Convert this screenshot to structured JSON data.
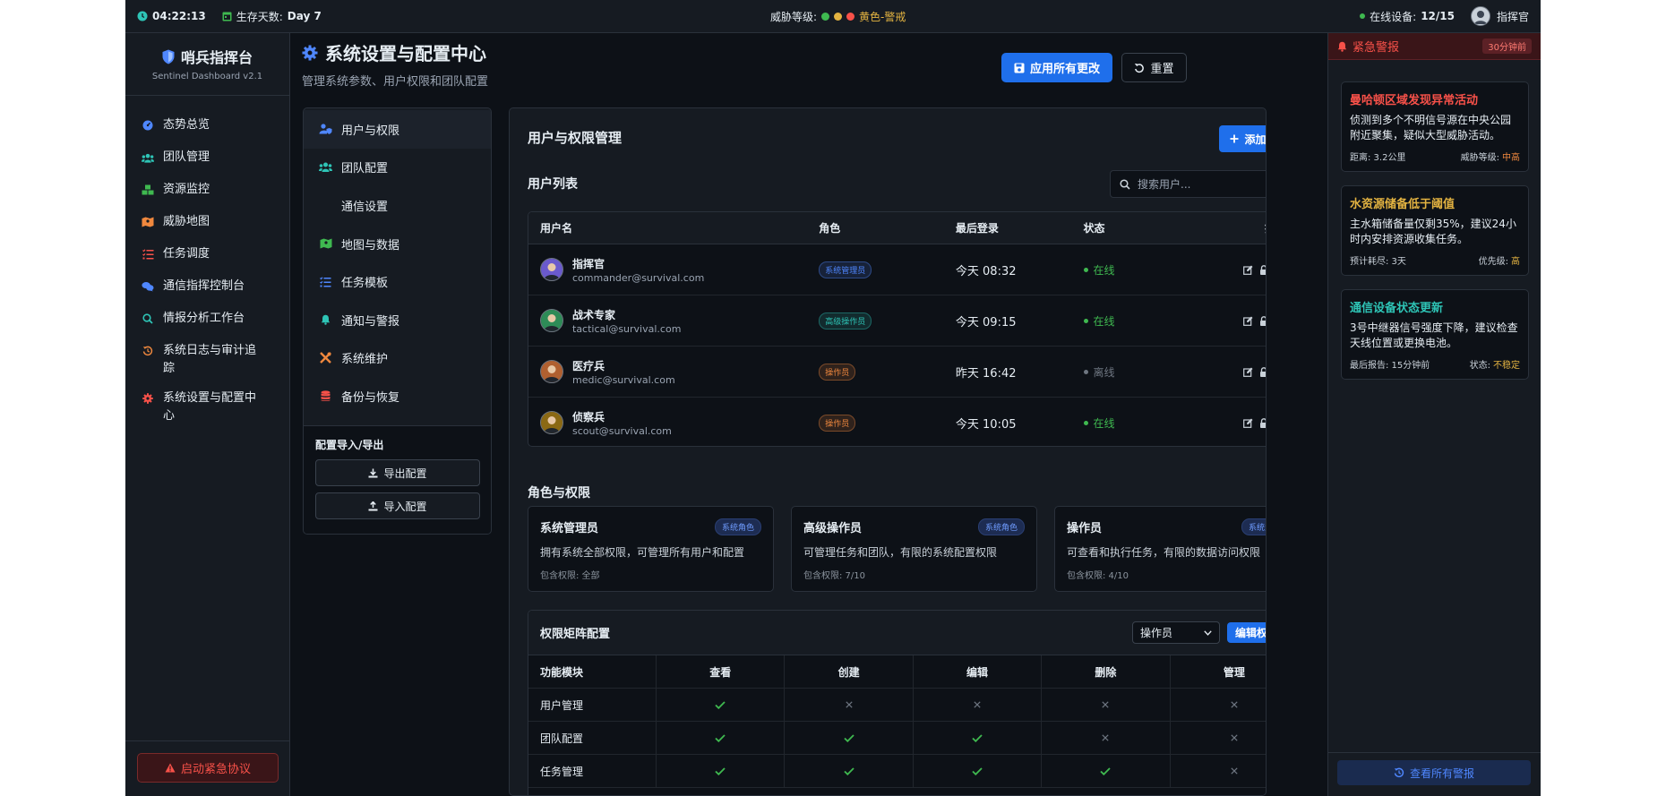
{
  "topbar": {
    "clock": "04:22:13",
    "survival_label": "生存天数:",
    "survival_value": "Day 7",
    "threat_label": "威胁等级:",
    "threat_value": "黄色-警戒",
    "online_label": "在线设备:",
    "online_value": "12/15",
    "user": "指挥官"
  },
  "brand": {
    "name": "哨兵指挥台",
    "sub": "Sentinel Dashboard v2.1"
  },
  "nav": [
    {
      "label": "态势总览",
      "icon": "gauge-icon",
      "color": "#4f87ff"
    },
    {
      "label": "团队管理",
      "icon": "users-icon",
      "color": "#2ec4b6"
    },
    {
      "label": "资源监控",
      "icon": "boxes-icon",
      "color": "#3fb950"
    },
    {
      "label": "威胁地图",
      "icon": "map-icon",
      "color": "#f0883e"
    },
    {
      "label": "任务调度",
      "icon": "tasks-icon",
      "color": "#f85149"
    },
    {
      "label": "通信指挥控制台",
      "icon": "comments-icon",
      "color": "#4f87ff"
    },
    {
      "label": "情报分析工作台",
      "icon": "search-icon",
      "color": "#2ec4b6"
    },
    {
      "label": "系统日志与审计追踪",
      "icon": "history-icon",
      "color": "#f0883e"
    },
    {
      "label": "系统设置与配置中心",
      "icon": "cog-icon",
      "color": "#f85149"
    }
  ],
  "emergency_button": "启动紧急协议",
  "page": {
    "title": "系统设置与配置中心",
    "subtitle": "管理系统参数、用户权限和团队配置",
    "apply": "应用所有更改",
    "reset": "重置"
  },
  "settings_menu": [
    {
      "label": "用户与权限",
      "icon": "user-shield-icon",
      "color": "#4f87ff"
    },
    {
      "label": "团队配置",
      "icon": "users-icon",
      "color": "#2ec4b6"
    },
    {
      "label": "通信设置",
      "icon": "",
      "color": ""
    },
    {
      "label": "地图与数据",
      "icon": "map-icon",
      "color": "#3fb950"
    },
    {
      "label": "任务模板",
      "icon": "tasks-icon",
      "color": "#4f87ff"
    },
    {
      "label": "通知与警报",
      "icon": "bell-icon",
      "color": "#2ec4b6"
    },
    {
      "label": "系统维护",
      "icon": "tools-icon",
      "color": "#f0883e"
    },
    {
      "label": "备份与恢复",
      "icon": "database-icon",
      "color": "#f85149"
    }
  ],
  "config_io": {
    "title": "配置导入/导出",
    "export": "导出配置",
    "import": "导入配置"
  },
  "users_section": {
    "title": "用户与权限管理",
    "add_user": "添加用户",
    "list_label": "用户列表",
    "search_placeholder": "搜索用户...",
    "columns": [
      "用户名",
      "角色",
      "最后登录",
      "状态",
      "操作"
    ],
    "rows": [
      {
        "name": "指挥官",
        "email": "commander@survival.com",
        "role": "系统管理员",
        "role_color": "#4f87ff",
        "last_login": "今天 08:32",
        "status": "在线",
        "online": true
      },
      {
        "name": "战术专家",
        "email": "tactical@survival.com",
        "role": "高级操作员",
        "role_color": "#2ec4b6",
        "last_login": "今天 09:15",
        "status": "在线",
        "online": true
      },
      {
        "name": "医疗兵",
        "email": "medic@survival.com",
        "role": "操作员",
        "role_color": "#f0883e",
        "last_login": "昨天 16:42",
        "status": "离线",
        "online": false
      },
      {
        "name": "侦察兵",
        "email": "scout@survival.com",
        "role": "操作员",
        "role_color": "#f0883e",
        "last_login": "今天 10:05",
        "status": "在线",
        "online": true
      }
    ]
  },
  "roles_section": {
    "title": "角色与权限",
    "cards": [
      {
        "name": "系统管理员",
        "badge": "系统角色",
        "desc": "拥有系统全部权限，可管理所有用户和配置",
        "perms": "包含权限: 全部"
      },
      {
        "name": "高级操作员",
        "badge": "系统角色",
        "desc": "可管理任务和团队，有限的系统配置权限",
        "perms": "包含权限: 7/10"
      },
      {
        "name": "操作员",
        "badge": "系统角色",
        "desc": "可查看和执行任务，有限的数据访问权限",
        "perms": "包含权限: 4/10"
      }
    ]
  },
  "matrix": {
    "title": "权限矩阵配置",
    "selected_role": "操作员",
    "edit": "编辑权限",
    "columns": [
      "功能模块",
      "查看",
      "创建",
      "编辑",
      "删除",
      "管理"
    ],
    "rows": [
      {
        "module": "用户管理",
        "perms": [
          true,
          false,
          false,
          false,
          false
        ]
      },
      {
        "module": "团队配置",
        "perms": [
          true,
          true,
          true,
          false,
          false
        ]
      },
      {
        "module": "任务管理",
        "perms": [
          true,
          true,
          true,
          true,
          false
        ]
      }
    ]
  },
  "alerts": {
    "title": "紧急警报",
    "time": "30分钟前",
    "view_all": "查看所有警报",
    "items": [
      {
        "title": "曼哈顿区域发现异常活动",
        "title_color": "#f85149",
        "desc": "侦测到多个不明信号源在中央公园附近聚集，疑似大型威胁活动。",
        "meta_left": "距离: 3.2公里",
        "meta_right_label": "威胁等级:",
        "meta_right_value": "中高",
        "value_color": "#f0883e"
      },
      {
        "title": "水资源储备低于阈值",
        "title_color": "#e3b341",
        "desc": "主水箱储备量仅剩35%，建议24小时内安排资源收集任务。",
        "meta_left": "预计耗尽: 3天",
        "meta_right_label": "优先级:",
        "meta_right_value": "高",
        "value_color": "#e3b341"
      },
      {
        "title": "通信设备状态更新",
        "title_color": "#2ec4b6",
        "desc": "3号中继器信号强度下降，建议检查天线位置或更换电池。",
        "meta_left": "最后报告: 15分钟前",
        "meta_right_label": "状态:",
        "meta_right_value": "不稳定",
        "value_color": "#e3b341"
      }
    ]
  }
}
